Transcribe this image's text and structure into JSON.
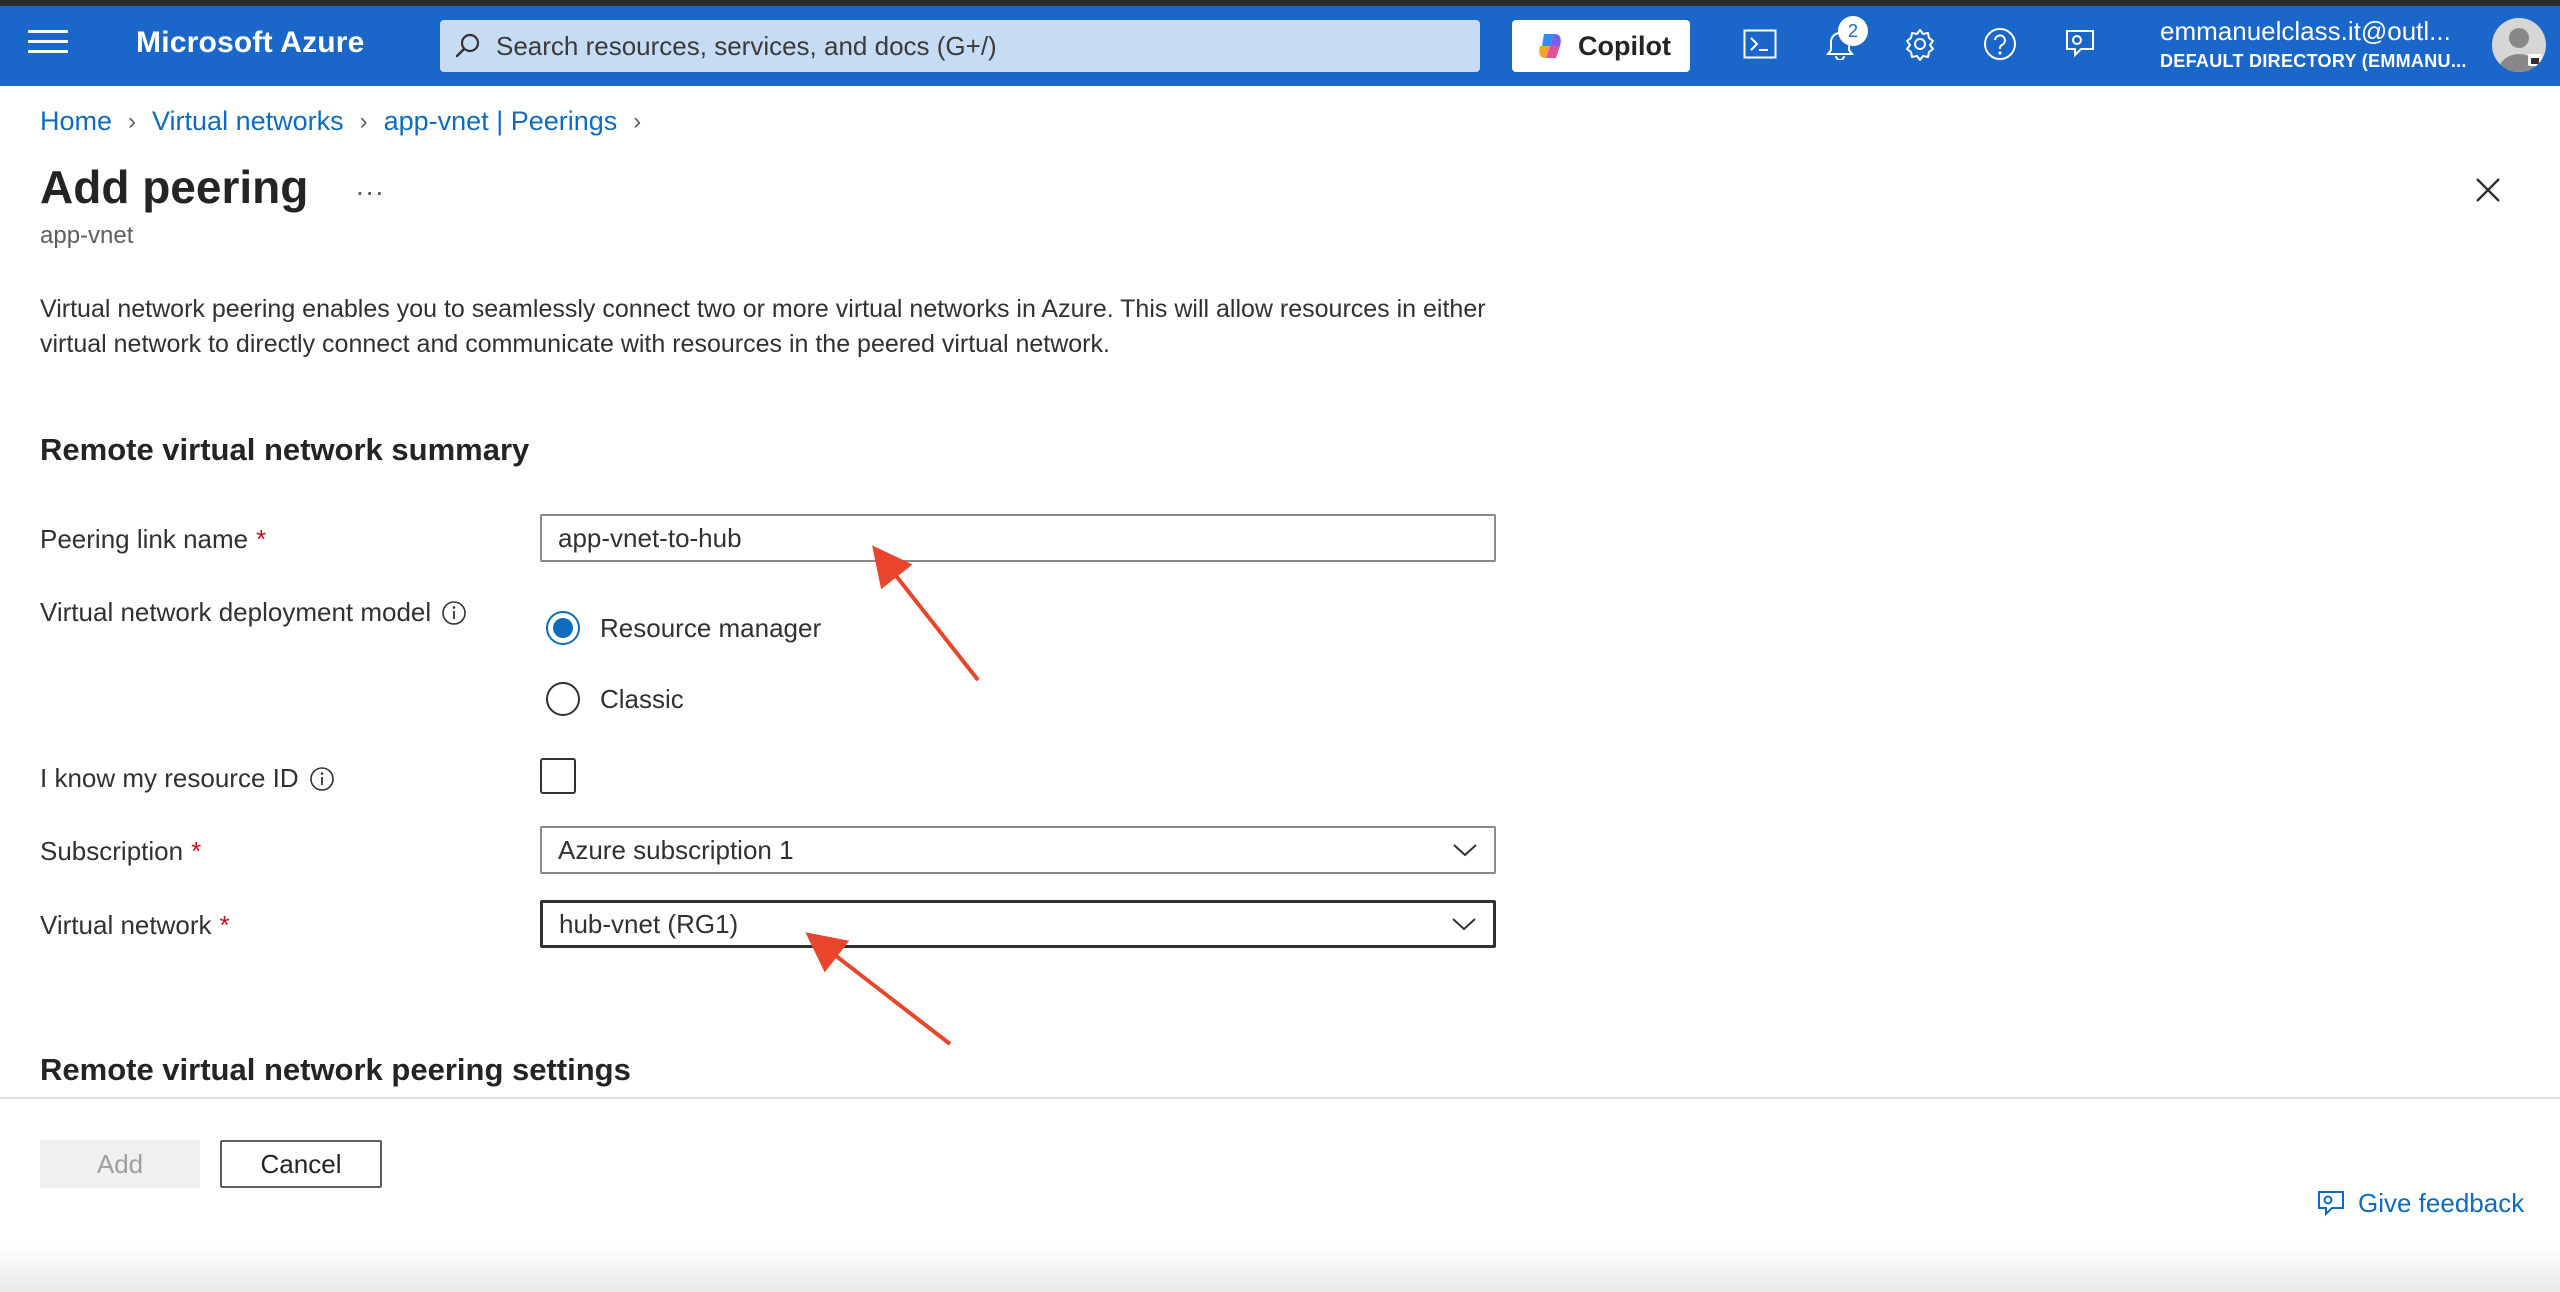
{
  "topbar": {
    "brand": "Microsoft Azure",
    "search_placeholder": "Search resources, services, and docs (G+/)",
    "copilot_label": "Copilot",
    "notification_count": "2",
    "account_email": "emmanuelclass.it@outl...",
    "account_directory": "DEFAULT DIRECTORY (EMMANU...",
    "brand_color": "#1b66c9"
  },
  "breadcrumb": {
    "items": [
      "Home",
      "Virtual networks",
      "app-vnet | Peerings"
    ]
  },
  "header": {
    "title": "Add peering",
    "more": "...",
    "subtitle": "app-vnet"
  },
  "description": "Virtual network peering enables you to seamlessly connect two or more virtual networks in Azure. This will allow resources in either virtual network to directly connect and communicate with resources in the peered virtual network.",
  "form": {
    "section_title": "Remote virtual network summary",
    "peering_link_label": "Peering link name",
    "required_mark": "*",
    "peering_link_value": "app-vnet-to-hub",
    "deployment_model_label": "Virtual network deployment model",
    "deployment_options": [
      "Resource manager",
      "Classic"
    ],
    "deployment_selected": "Resource manager",
    "resource_id_label": "I know my resource ID",
    "resource_id_checked": false,
    "subscription_label": "Subscription",
    "subscription_value": "Azure subscription 1",
    "vnet_label": "Virtual network",
    "vnet_value": "hub-vnet (RG1)",
    "settings_section_title": "Remote virtual network peering settings"
  },
  "footer": {
    "add_label": "Add",
    "cancel_label": "Cancel",
    "feedback_label": "Give feedback"
  },
  "annotations": {
    "arrow_color": "#e8452c"
  }
}
